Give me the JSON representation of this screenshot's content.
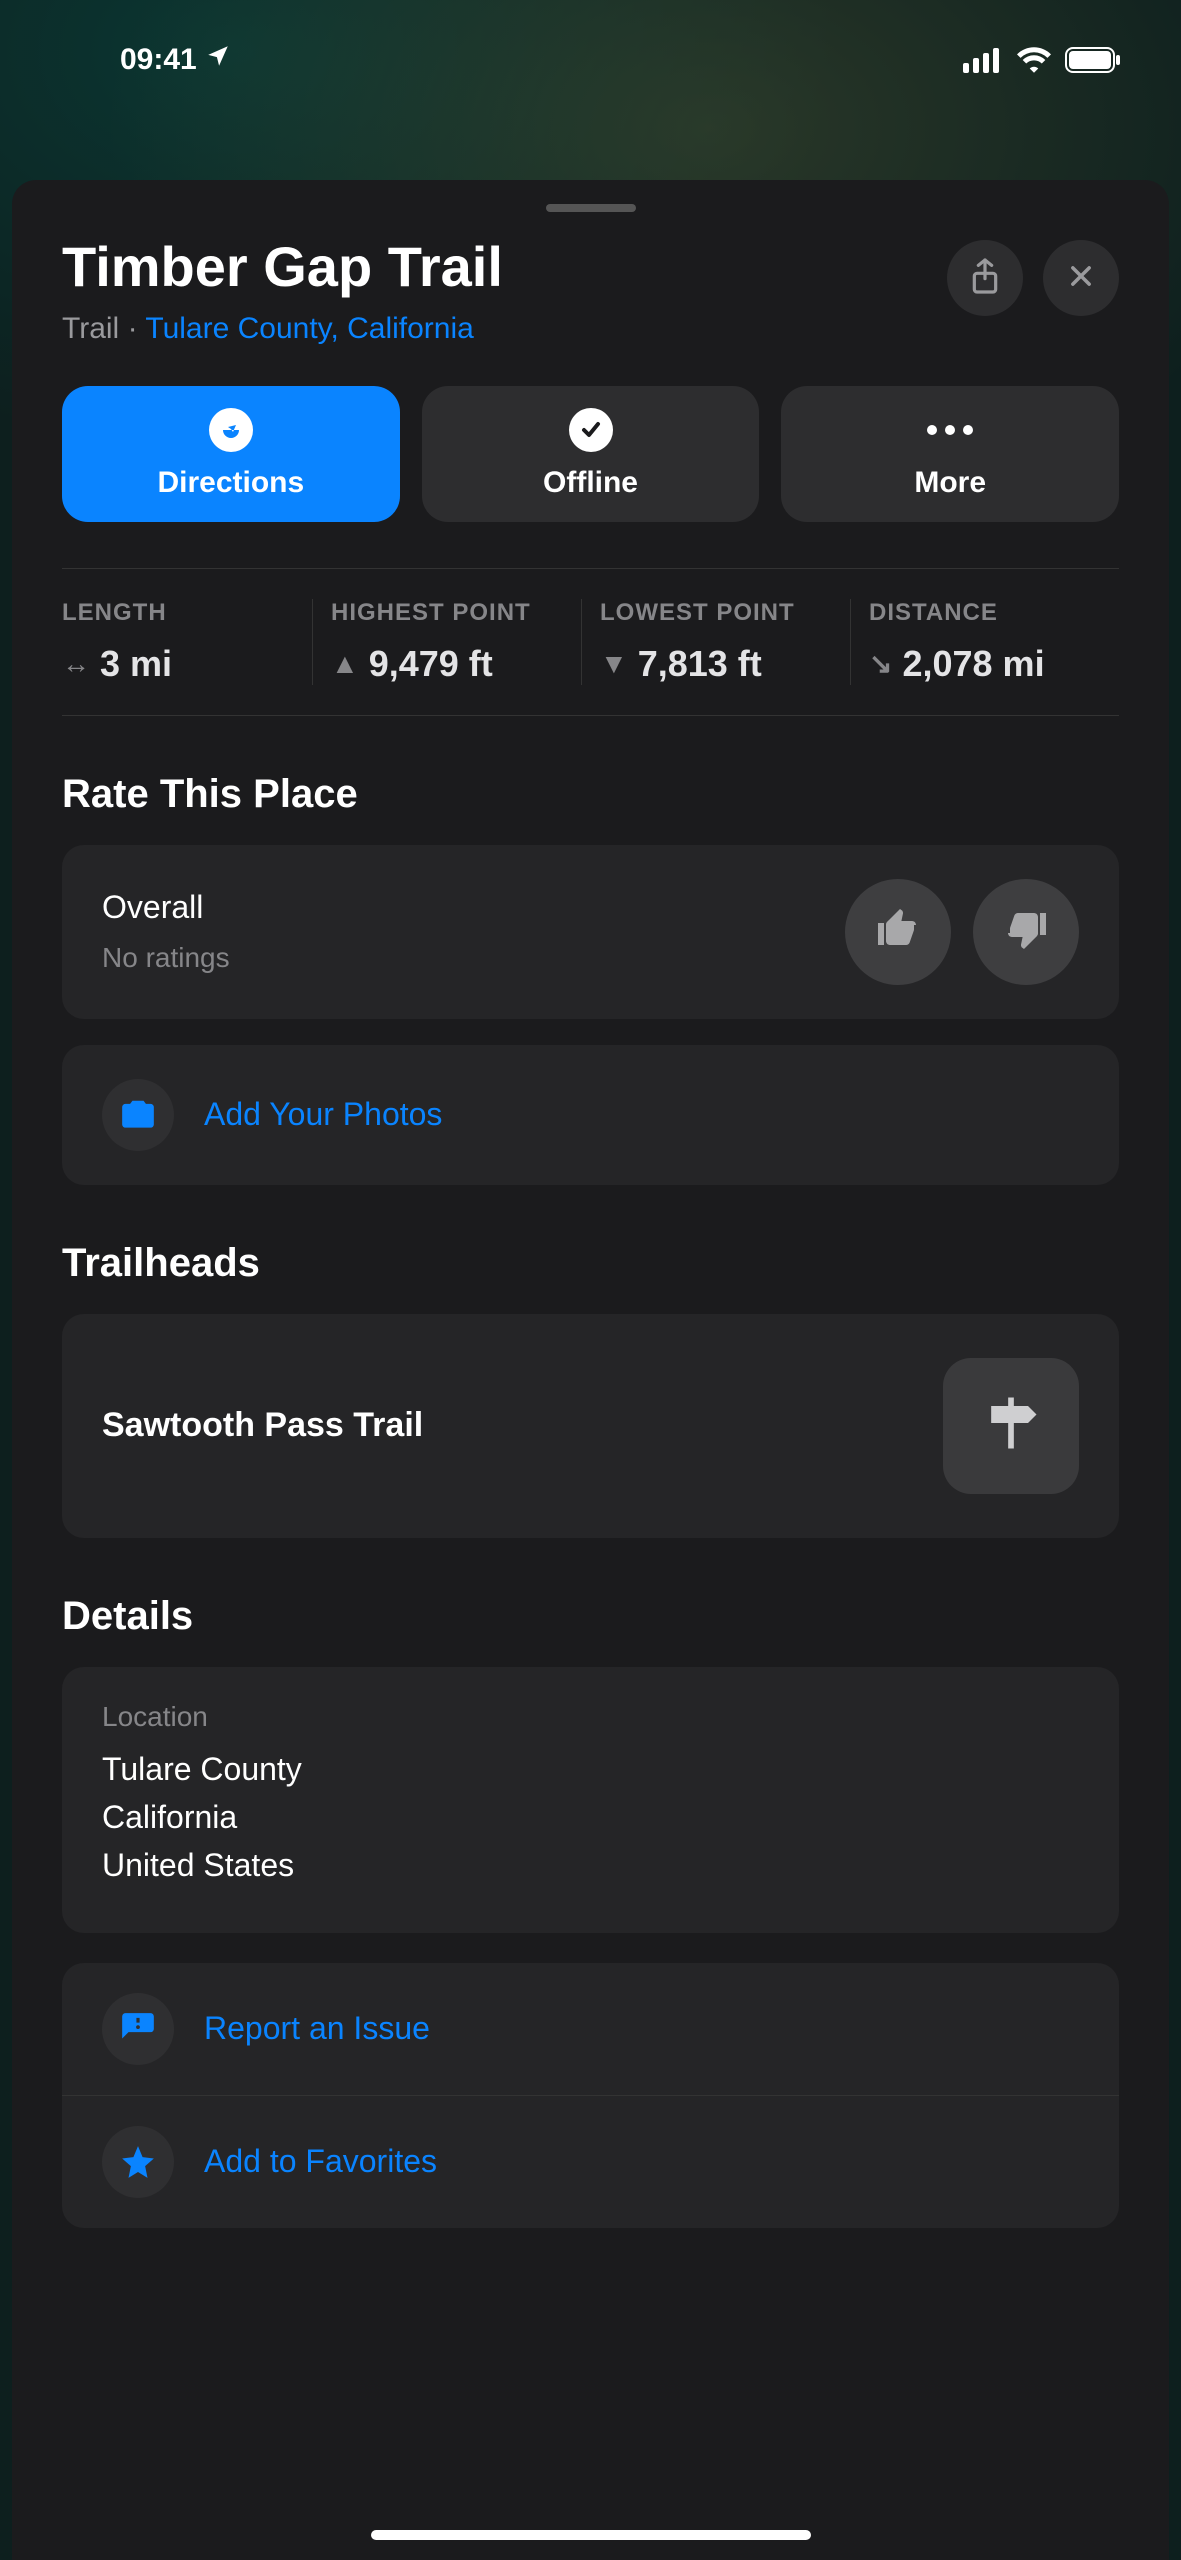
{
  "status": {
    "time": "09:41"
  },
  "place": {
    "title": "Timber Gap Trail",
    "type": "Trail",
    "location_link": "Tulare County, California"
  },
  "actions": {
    "directions": "Directions",
    "offline": "Offline",
    "more": "More"
  },
  "stats": {
    "length": {
      "label": "LENGTH",
      "value": "3 mi"
    },
    "highest": {
      "label": "HIGHEST POINT",
      "value": "9,479 ft"
    },
    "lowest": {
      "label": "LOWEST POINT",
      "value": "7,813 ft"
    },
    "distance": {
      "label": "DISTANCE",
      "value": "2,078 mi"
    }
  },
  "rate": {
    "section_title": "Rate This Place",
    "overall_label": "Overall",
    "ratings_text": "No ratings"
  },
  "photos": {
    "add_label": "Add Your Photos"
  },
  "trailheads": {
    "section_title": "Trailheads",
    "items": [
      {
        "name": "Sawtooth Pass Trail"
      }
    ]
  },
  "details": {
    "section_title": "Details",
    "location_label": "Location",
    "lines": [
      "Tulare County",
      "California",
      "United States"
    ]
  },
  "footer": {
    "report": "Report an Issue",
    "favorite": "Add to Favorites"
  }
}
